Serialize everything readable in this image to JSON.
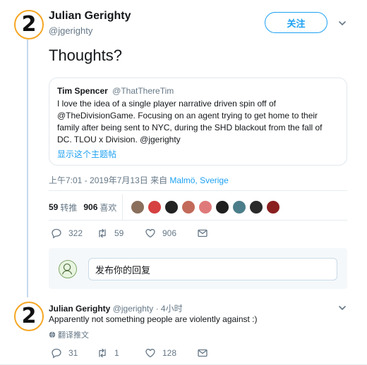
{
  "main_tweet": {
    "author_name": "Julian Gerighty",
    "author_handle": "@jgerighty",
    "avatar_glyph": "2",
    "follow_label": "关注",
    "text": "Thoughts?",
    "quote": {
      "author_name": "Tim Spencer",
      "author_handle": "@ThatThereTim",
      "body": "I love the idea of a single player narrative driven spin off of @TheDivisionGame. Focusing on an agent trying to get home to their family after being sent to NYC, during the SHD blackout from the fall of DC. TLOU x Division. @jgerighty",
      "show_thread": "显示这个主题帖"
    },
    "timestamp": "上午7:01 - 2019年7月13日 来自",
    "location": "Malmö, Sverige",
    "retweets_count": "59",
    "retweets_label": "转推",
    "likes_count": "906",
    "likes_label": "喜欢",
    "likers_colors": [
      "#8a6f5c",
      "#d64040",
      "#222222",
      "#c26a5a",
      "#e07a7a",
      "#1f1f1f",
      "#4b7e8a",
      "#2a2a2a",
      "#8b2020"
    ],
    "actions": {
      "reply": "322",
      "retweet": "59",
      "like": "906"
    }
  },
  "reply_composer": {
    "placeholder": "发布你的回复"
  },
  "reply_tweet": {
    "author_name": "Julian Gerighty",
    "author_handle": "@jgerighty",
    "time": "· 4小时",
    "avatar_glyph": "2",
    "text": "Apparently not something people are violently against :)",
    "translate_label": "翻译推文",
    "actions": {
      "reply": "31",
      "retweet": "1",
      "like": "128"
    }
  },
  "colors": {
    "accent": "#1da1f2",
    "badge_ring": "#f5a623",
    "muted": "#657786"
  }
}
